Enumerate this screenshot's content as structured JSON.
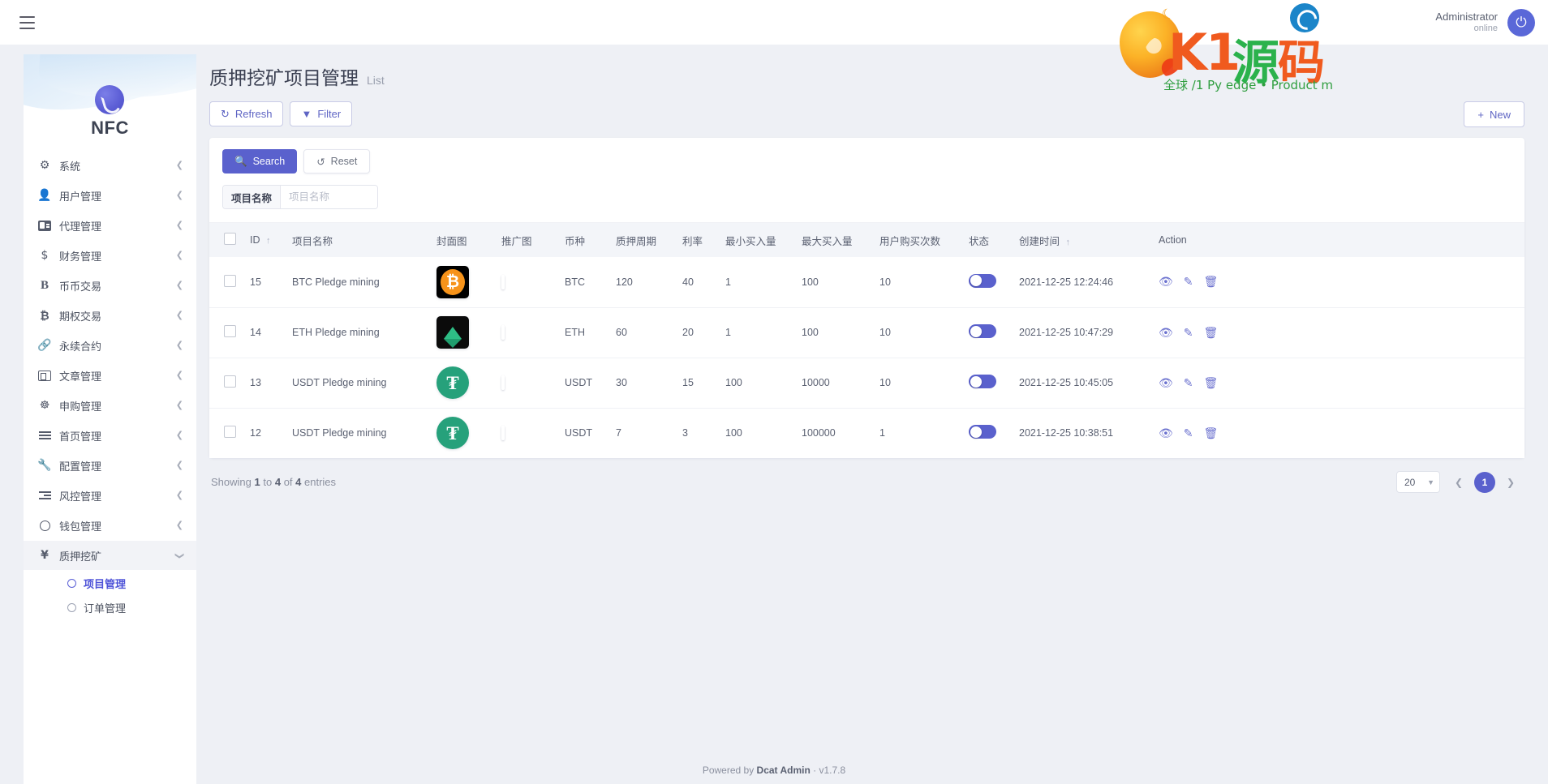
{
  "topbar": {
    "menu_icon": "hamburger-icon",
    "admin_name": "Administrator",
    "admin_status": "online",
    "power_icon": "power-icon"
  },
  "watermark": {
    "k1": "K1",
    "yuan": "源",
    "ma": "码",
    "subtitle": "全球 /1 Py edge • Product m"
  },
  "sidebar": {
    "brand": "NFC",
    "items": [
      {
        "label": "系统",
        "icon": "gear-icon",
        "arrow": "chevron-left"
      },
      {
        "label": "用户管理",
        "icon": "user-icon",
        "arrow": "chevron-left"
      },
      {
        "label": "代理管理",
        "icon": "id-card-icon",
        "arrow": "chevron-left"
      },
      {
        "label": "财务管理",
        "icon": "dollar-icon",
        "arrow": "chevron-left"
      },
      {
        "label": "币币交易",
        "icon": "letter-b-icon",
        "arrow": "chevron-left"
      },
      {
        "label": "期权交易",
        "icon": "bitcoin-icon",
        "arrow": "chevron-left"
      },
      {
        "label": "永续合约",
        "icon": "link-icon",
        "arrow": "chevron-left"
      },
      {
        "label": "文章管理",
        "icon": "news-icon",
        "arrow": "chevron-left"
      },
      {
        "label": "申购管理",
        "icon": "lifebuoy-icon",
        "arrow": "chevron-left"
      },
      {
        "label": "首页管理",
        "icon": "lines-icon",
        "arrow": "chevron-left"
      },
      {
        "label": "配置管理",
        "icon": "wrench-icon",
        "arrow": "chevron-left"
      },
      {
        "label": "风控管理",
        "icon": "flow-icon",
        "arrow": "chevron-left"
      },
      {
        "label": "钱包管理",
        "icon": "circle-icon",
        "arrow": "chevron-left"
      }
    ],
    "active_group": {
      "label": "质押挖矿",
      "icon": "yen-icon",
      "arrow": "chevron-down"
    },
    "submenu": [
      {
        "label": "项目管理",
        "active": true
      },
      {
        "label": "订单管理",
        "active": false
      }
    ]
  },
  "page": {
    "title": "质押挖矿项目管理",
    "subtitle": "List"
  },
  "toolbar": {
    "refresh_label": "Refresh",
    "refresh_icon": "refresh-icon",
    "filter_label": "Filter",
    "filter_icon": "funnel-icon",
    "new_label": "New",
    "new_icon": "plus-icon"
  },
  "filter": {
    "search_label": "Search",
    "search_icon": "search-icon",
    "reset_label": "Reset",
    "reset_icon": "undo-icon",
    "field_label": "项目名称",
    "field_value": "",
    "field_placeholder": "项目名称"
  },
  "table": {
    "columns": [
      {
        "key": "check",
        "label": "",
        "sort": ""
      },
      {
        "key": "id",
        "label": "ID",
        "sort": "asc"
      },
      {
        "key": "name",
        "label": "项目名称",
        "sort": ""
      },
      {
        "key": "cover",
        "label": "封面图",
        "sort": ""
      },
      {
        "key": "promo",
        "label": "推广图",
        "sort": ""
      },
      {
        "key": "coin",
        "label": "币种",
        "sort": ""
      },
      {
        "key": "period",
        "label": "质押周期",
        "sort": ""
      },
      {
        "key": "rate",
        "label": "利率",
        "sort": ""
      },
      {
        "key": "min_buy",
        "label": "最小买入量",
        "sort": ""
      },
      {
        "key": "max_buy",
        "label": "最大买入量",
        "sort": ""
      },
      {
        "key": "buy_times",
        "label": "用户购买次数",
        "sort": ""
      },
      {
        "key": "status",
        "label": "状态",
        "sort": ""
      },
      {
        "key": "created_at",
        "label": "创建时间",
        "sort": "asc"
      },
      {
        "key": "action",
        "label": "Action",
        "sort": ""
      }
    ],
    "rows": [
      {
        "id": "15",
        "name": "BTC Pledge mining",
        "cover_icon": "bitcoin-logo",
        "promo_icon": "promo-dark",
        "coin": "BTC",
        "period": "120",
        "rate": "40",
        "min_buy": "1",
        "max_buy": "100",
        "buy_times": "10",
        "status_on": true,
        "created_at": "2021-12-25 12:24:46",
        "actions": [
          "eye-icon",
          "pencil-icon",
          "trash-icon"
        ]
      },
      {
        "id": "14",
        "name": "ETH Pledge mining",
        "cover_icon": "ethereum-logo",
        "promo_icon": "promo-red",
        "coin": "ETH",
        "period": "60",
        "rate": "20",
        "min_buy": "1",
        "max_buy": "100",
        "buy_times": "10",
        "status_on": true,
        "created_at": "2021-12-25 10:47:29",
        "actions": [
          "eye-icon",
          "pencil-icon",
          "trash-icon"
        ]
      },
      {
        "id": "13",
        "name": "USDT Pledge mining",
        "cover_icon": "tether-logo",
        "promo_icon": "promo-red",
        "coin": "USDT",
        "period": "30",
        "rate": "15",
        "min_buy": "100",
        "max_buy": "10000",
        "buy_times": "10",
        "status_on": true,
        "created_at": "2021-12-25 10:45:05",
        "actions": [
          "eye-icon",
          "pencil-icon",
          "trash-icon"
        ]
      },
      {
        "id": "12",
        "name": "USDT Pledge mining",
        "cover_icon": "tether-logo",
        "promo_icon": "promo-red",
        "coin": "USDT",
        "period": "7",
        "rate": "3",
        "min_buy": "100",
        "max_buy": "100000",
        "buy_times": "1",
        "status_on": true,
        "created_at": "2021-12-25 10:38:51",
        "actions": [
          "eye-icon",
          "pencil-icon",
          "trash-icon"
        ]
      }
    ]
  },
  "pagination": {
    "showing_prefix": "Showing",
    "from": "1",
    "to_word": "to",
    "to": "4",
    "of_word": "of",
    "total": "4",
    "entries_word": "entries",
    "per_page": "20",
    "prev_icon": "chevron-left-icon",
    "current_page": "1",
    "next_icon": "chevron-right-icon"
  },
  "footer": {
    "prefix": "Powered by",
    "brand": "Dcat Admin",
    "sep": "·",
    "version": "v1.7.8"
  },
  "colors": {
    "accent": "#5a61cd",
    "page_bg": "#eef0f5",
    "card_bg": "#ffffff"
  }
}
